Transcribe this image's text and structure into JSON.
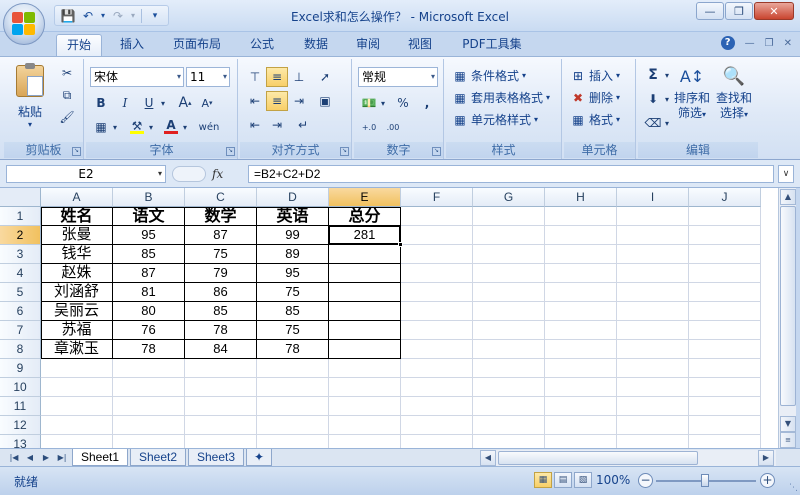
{
  "window": {
    "title": "Excel求和怎么操作？ - Microsoft Excel",
    "minimize_icon": "minimize-icon",
    "restore_icon": "restore-icon",
    "close_icon": "close-icon"
  },
  "quick_access": {
    "items": [
      "save-icon",
      "undo-icon",
      "redo-icon",
      "customize-icon"
    ]
  },
  "tabs": [
    "开始",
    "插入",
    "页面布局",
    "公式",
    "数据",
    "审阅",
    "视图",
    "PDF工具集"
  ],
  "active_tab": "开始",
  "ribbon": {
    "clipboard": {
      "label": "剪贴板",
      "paste": "粘贴"
    },
    "font": {
      "label": "字体",
      "font_name": "宋体",
      "font_size": "11"
    },
    "alignment": {
      "label": "对齐方式"
    },
    "number": {
      "label": "数字",
      "format": "常规",
      "percent": "%",
      "comma": ",",
      "inc_decimal": ".00→.0",
      "dec_decimal": ".00→.0"
    },
    "styles": {
      "label": "样式",
      "conditional": "条件格式",
      "table": "套用表格格式",
      "cell_styles": "单元格样式"
    },
    "cells": {
      "label": "单元格",
      "insert": "插入",
      "delete": "删除",
      "format": "格式"
    },
    "editing": {
      "label": "编辑",
      "sort_filter_1": "排序和",
      "sort_filter_2": "筛选",
      "find_select_1": "查找和",
      "find_select_2": "选择"
    }
  },
  "formula_bar": {
    "name_box": "E2",
    "fx": "fx",
    "formula": "=B2+C2+D2"
  },
  "columns": [
    "A",
    "B",
    "C",
    "D",
    "E",
    "F",
    "G",
    "H",
    "I",
    "J"
  ],
  "selected_column": "E",
  "rows": [
    "1",
    "2",
    "3",
    "4",
    "5",
    "6",
    "7",
    "8",
    "9",
    "10",
    "11",
    "12",
    "13"
  ],
  "selected_row": "2",
  "table": {
    "headers": [
      "姓名",
      "语文",
      "数学",
      "英语",
      "总分"
    ],
    "records": [
      [
        "张曼",
        "95",
        "87",
        "99",
        "281"
      ],
      [
        "钱华",
        "85",
        "75",
        "89",
        ""
      ],
      [
        "赵姝",
        "87",
        "79",
        "95",
        ""
      ],
      [
        "刘涵舒",
        "81",
        "86",
        "75",
        ""
      ],
      [
        "吴丽云",
        "80",
        "85",
        "85",
        ""
      ],
      [
        "苏福",
        "76",
        "78",
        "75",
        ""
      ],
      [
        "章漱玉",
        "78",
        "84",
        "78",
        ""
      ]
    ]
  },
  "sheets": [
    "Sheet1",
    "Sheet2",
    "Sheet3"
  ],
  "active_sheet": "Sheet1",
  "status": {
    "ready": "就绪",
    "zoom": "100%"
  }
}
